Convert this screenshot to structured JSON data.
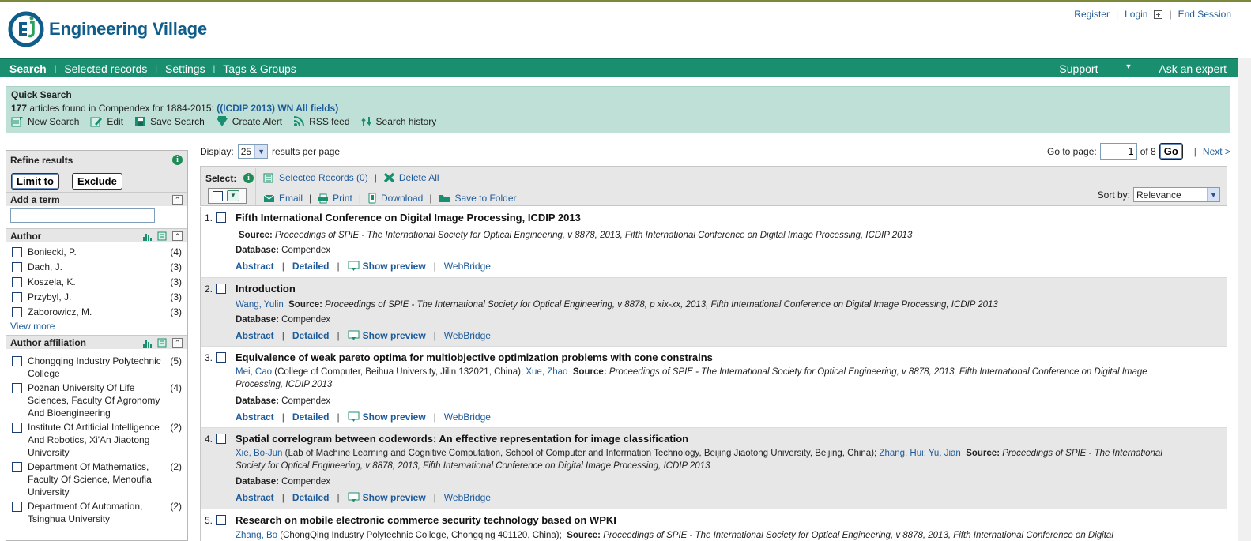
{
  "header": {
    "logo_text": "Engineering Village",
    "links": {
      "register": "Register",
      "login": "Login",
      "end_session": "End Session"
    }
  },
  "nav": {
    "items": [
      "Search",
      "Selected records",
      "Settings",
      "Tags & Groups"
    ],
    "support": "Support",
    "ask_expert": "Ask an expert"
  },
  "quick_search": {
    "title": "Quick Search",
    "count": "177",
    "found_text": "articles found in Compendex for 1884-2015:",
    "query": "((ICDIP 2013) WN All fields)",
    "tools": [
      "New Search",
      "Edit",
      "Save Search",
      "Create Alert",
      "RSS feed",
      "Search history"
    ]
  },
  "sidebar": {
    "title": "Refine results",
    "limit_to": "Limit to",
    "exclude": "Exclude",
    "add_term_label": "Add a term",
    "add_term_value": "",
    "author_label": "Author",
    "authors": [
      {
        "name": "Boniecki, P.",
        "count": "(4)"
      },
      {
        "name": "Dach, J.",
        "count": "(3)"
      },
      {
        "name": "Koszela, K.",
        "count": "(3)"
      },
      {
        "name": "Przybyl, J.",
        "count": "(3)"
      },
      {
        "name": "Zaborowicz, M.",
        "count": "(3)"
      }
    ],
    "view_more": "View more",
    "affiliation_label": "Author affiliation",
    "affiliations": [
      {
        "name": "Chongqing Industry Polytechnic College",
        "count": "(5)"
      },
      {
        "name": "Poznan University Of Life Sciences, Faculty Of Agronomy And Bioengineering",
        "count": "(4)"
      },
      {
        "name": "Institute Of Artificial Intelligence And Robotics, Xi'An Jiaotong University",
        "count": "(2)"
      },
      {
        "name": "Department Of Mathematics, Faculty Of Science, Menoufia University",
        "count": "(2)"
      },
      {
        "name": "Department Of Automation, Tsinghua University",
        "count": "(2)"
      }
    ]
  },
  "display": {
    "label": "Display:",
    "per_page_value": "25",
    "suffix": "results per page"
  },
  "pager": {
    "goto_label": "Go to page:",
    "page_value": "1",
    "of_text": "of 8",
    "go": "Go",
    "next": "Next >"
  },
  "toolbar": {
    "select_label": "Select:",
    "selected_records": "Selected Records (0)",
    "delete_all": "Delete All",
    "email": "Email",
    "print": "Print",
    "download": "Download",
    "save_to_folder": "Save to Folder",
    "sort_label": "Sort by:",
    "sort_value": "Relevance"
  },
  "record_labels": {
    "source": "Source:",
    "database": "Database:",
    "abstract": "Abstract",
    "detailed": "Detailed",
    "show_preview": "Show preview",
    "webbridge": "WebBridge"
  },
  "records": [
    {
      "num": "1.",
      "title": "Fifth International Conference on Digital Image Processing, ICDIP 2013",
      "authors_html": "",
      "source": "Proceedings of SPIE - The International Society for Optical Engineering, v 8878, 2013, Fifth International Conference on Digital Image Processing, ICDIP 2013",
      "database": "Compendex"
    },
    {
      "num": "2.",
      "title": "Introduction",
      "authors": "Wang, Yulin",
      "source": "Proceedings of SPIE - The International Society for Optical Engineering, v 8878, p xix-xx, 2013, Fifth International Conference on Digital Image Processing, ICDIP 2013",
      "database": "Compendex"
    },
    {
      "num": "3.",
      "title": "Equivalence of weak pareto optima for multiobjective optimization problems with cone constrains",
      "author1": "Mei, Cao",
      "affil1": "(College of Computer, Beihua University, Jilin 132021, China);",
      "author2": "Xue, Zhao",
      "source": "Proceedings of SPIE - The International Society for Optical Engineering, v 8878, 2013, Fifth International Conference on Digital Image Processing, ICDIP 2013",
      "database": "Compendex"
    },
    {
      "num": "4.",
      "title": "Spatial correlogram between codewords: An effective representation for image classification",
      "author1": "Xie, Bo-Jun",
      "affil1": "(Lab of Machine Learning and Cognitive Computation, School of Computer and Information Technology, Beijing Jiaotong University, Beijing, China);",
      "author2": "Zhang, Hui;",
      "author3": "Yu, Jian",
      "source": "Proceedings of SPIE - The International Society for Optical Engineering, v 8878, 2013, Fifth International Conference on Digital Image Processing, ICDIP 2013",
      "database": "Compendex"
    },
    {
      "num": "5.",
      "title": "Research on mobile electronic commerce security technology based on WPKI",
      "author1": "Zhang, Bo",
      "affil1": "(ChongQing Industry Polytechnic College, Chongqing 401120, China);",
      "source": "Proceedings of SPIE - The International Society for Optical Engineering, v 8878, 2013, Fifth International Conference on Digital"
    }
  ],
  "colors": {
    "nav_green": "#1a8f70",
    "quicksearch_bg": "#bfe0d7",
    "link_blue": "#1e5b9a",
    "logo_blue": "#0f5d8a"
  }
}
